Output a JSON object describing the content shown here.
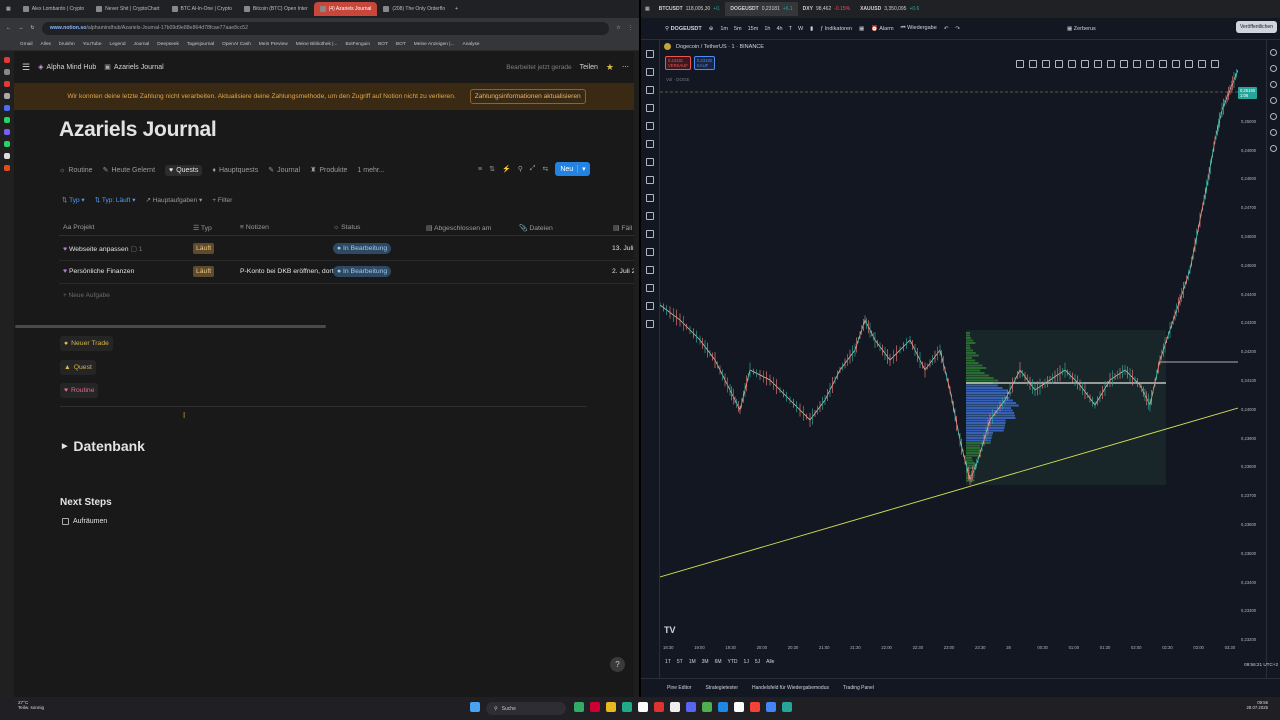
{
  "left_browser": {
    "tabs": [
      {
        "label": "Alex Lombardo | Crypto",
        "active": false
      },
      {
        "label": "Never Shit | CryptoChart",
        "active": false
      },
      {
        "label": "BTC Al-In-One | Crypto",
        "active": false
      },
      {
        "label": "Bitcoin (BTC) Open Inter",
        "active": false
      },
      {
        "label": "(4) Azariels Journal",
        "active": true
      },
      {
        "label": "(208) The Only Orderflo",
        "active": false
      }
    ],
    "url_host": "www.notion.so",
    "url_path": "/alphamindhub/Azariels-Journal-17b09d9e88e864d78fcae77aae8cc52",
    "bookmarks": [
      "Gmail",
      "Alles",
      "bruishn",
      "YouTube",
      "Legend",
      "Journal",
      "Deepseek",
      "Tagesjournal",
      "OpenAI Cash",
      "Mein Preview",
      "Meine Bibliothek |...",
      "BotFenguin",
      "BOT",
      "BOT",
      "Meine Anzeigen |...",
      "Analyse"
    ]
  },
  "notion": {
    "workspace": "Alpha Mind Hub",
    "breadcrumb_page": "Azariels Journal",
    "edited_status": "Bearbeitet jetzt gerade",
    "share_label": "Teilen",
    "banner_text": "Wir konnten deine letzte Zahlung nicht verarbeiten. Aktualisiere deine Zahlungsmethode, um den Zugriff auf Notion nicht zu verlieren.",
    "banner_button": "Zahlungsinformationen aktualisieren",
    "page_title": "Azariels Journal",
    "views": [
      "Routine",
      "Heute Gelernt",
      "Quests",
      "Hauptquests",
      "Journal",
      "Produkte",
      "1 mehr..."
    ],
    "active_view": "Quests",
    "new_button": "Neu",
    "filters": {
      "typ": "Typ",
      "typ_laeuft": "Typ: Läuft",
      "haupt": "Hauptaufgaben",
      "filter": "+ Filter"
    },
    "columns": [
      "Projekt",
      "Typ",
      "Notizen",
      "Status",
      "Abgeschlossen am",
      "Dateien",
      "Fäll"
    ],
    "rows": [
      {
        "projekt": "Webseite anpassen",
        "comments": "1",
        "typ": "Läuft",
        "notizen": "",
        "status": "In Bearbeitung",
        "faellig": "13. Juli"
      },
      {
        "projekt": "Persönliche Finanzen",
        "comments": "",
        "typ": "Läuft",
        "notizen": "P-Konto bei DKB eröffnen, dort",
        "status": "In Bearbeitung",
        "faellig": "2. Juli 2"
      }
    ],
    "new_task": "+ Neue Aufgabe",
    "buttons": [
      {
        "label": "Neuer Trade",
        "color": "#e0b84a"
      },
      {
        "label": "Quest",
        "color": "#e0b84a"
      },
      {
        "label": "Routine",
        "color": "#e06a8a"
      }
    ],
    "toggle_heading": "Datenbank",
    "next_steps_heading": "Next Steps",
    "todo_item": "Aufräumen",
    "help_label": "?"
  },
  "right_browser": {
    "tabs": [
      {
        "label": "BTCUSDT",
        "value": "118,005,30",
        "change": "+0.",
        "dir": "up"
      },
      {
        "label": "DOGEUSDT",
        "value": "0,23181",
        "change": "+6.1",
        "dir": "up"
      },
      {
        "label": "DXY",
        "value": "98,462",
        "change": "-0.15%",
        "dir": "dn"
      },
      {
        "label": "XAUUSD",
        "value": "3,350,095",
        "change": "+0.6",
        "dir": "up"
      }
    ]
  },
  "tradingview": {
    "symbol": "DOGEUSDT",
    "timeframes_top": [
      "1m",
      "5m",
      "15m",
      "1h",
      "4h",
      "T",
      "W"
    ],
    "indicators_label": "Indikatoren",
    "alarm_label": "Alarm",
    "replay_label": "Wiedergabe",
    "layout_label": "Zerberus",
    "publish_label": "Veröffentlichen",
    "legend_title": "Dogecoin / TetherUS · 1 · BINANCE",
    "sell_price": "0,23181",
    "sell_label": "VERKAUF",
    "buy_price": "0,23182",
    "buy_label": "KAUF",
    "vol_label": "Vol · DOGE",
    "current_price": "0,25160",
    "current_price_small": "1:06",
    "y_ticks": [
      "0,25200",
      "0,25000",
      "0,24900",
      "0,24800",
      "0,24700",
      "0,24600",
      "0,24500",
      "0,24400",
      "0,24300",
      "0,24200",
      "0,24100",
      "0,24000",
      "0,23900",
      "0,23800",
      "0,23700",
      "0,23600",
      "0,23500",
      "0,23400",
      "0,23300",
      "0,23200"
    ],
    "x_ticks": [
      "18:30",
      "19:00",
      "19:30",
      "20:00",
      "20:30",
      "21:00",
      "21:30",
      "22:00",
      "22:30",
      "23:00",
      "23:30",
      "28",
      "00:30",
      "01:00",
      "01:30",
      "02:00",
      "02:30",
      "03:00",
      "03:30"
    ],
    "range_buttons": [
      "1T",
      "5T",
      "1M",
      "3M",
      "6M",
      "YTD",
      "1J",
      "5J",
      "Alle"
    ],
    "clock": "09:56:21 UTC+2",
    "bottom_tabs": [
      "Pine Editor",
      "Strategietester",
      "Handelsfeld für Wiedergabemodus",
      "Trading Panel"
    ]
  },
  "taskbar": {
    "weather_temp": "27°C",
    "weather_desc": "Teilw. sonnig",
    "search_label": "Suche",
    "time": "09:56",
    "date": "28.07.2025"
  },
  "colors": {
    "notion_bg": "#191919",
    "tv_bg": "#131722",
    "banner_bg": "#3a2a14",
    "accent_blue": "#2383e2",
    "trend_line": "#d4e157",
    "price_tag": "#26a69a"
  }
}
